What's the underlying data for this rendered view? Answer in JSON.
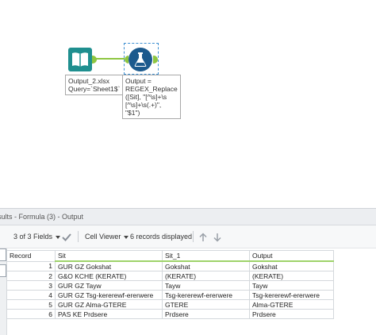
{
  "canvas": {
    "input_tool": {
      "icon": "book-icon",
      "annotation": [
        "Output_2.xlsx",
        "Query=`Sheet1$`"
      ]
    },
    "formula_tool": {
      "icon": "flask-icon",
      "annotation": [
        "Output =",
        "REGEX_Replace",
        "([Sit], \"[^\\s]+\\s",
        "[^\\s]+\\s(.+)\",",
        "\"$1\")"
      ]
    },
    "connection_color": "#8ec641"
  },
  "results": {
    "title": "sults - Formula (3) - Output",
    "fields_label": "3 of 3 Fields",
    "cell_viewer_label": "Cell Viewer",
    "records_label": "6 records displayed",
    "columns": [
      "Record",
      "Sit",
      "Sit_1",
      "Output"
    ],
    "rows": [
      [
        "1",
        "GUR GZ Gokshat",
        "Gokshat",
        "Gokshat"
      ],
      [
        "2",
        "G&O KCHE (KERATE)",
        "(KERATE)",
        "(KERATE)"
      ],
      [
        "3",
        "GUR GZ Tayw",
        "Tayw",
        "Tayw"
      ],
      [
        "4",
        "GUR GZ Tsg-kererewf-ererwere",
        "Tsg-kererewf-ererwere",
        "Tsg-kererewf-ererwere"
      ],
      [
        "5",
        "GUR GZ Alma-GTERE",
        "GTERE",
        "Alma-GTERE"
      ],
      [
        "6",
        "PAS KE Prdsere",
        "Prdsere",
        "Prdsere"
      ]
    ]
  }
}
